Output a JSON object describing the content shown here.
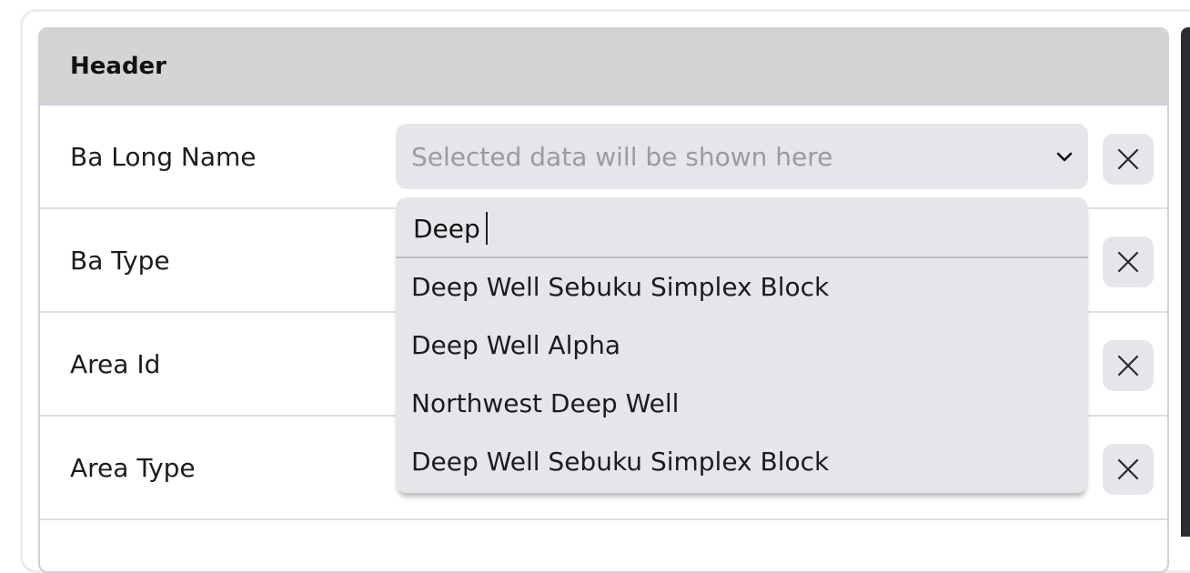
{
  "panel": {
    "header_title": "Header"
  },
  "rows": [
    {
      "label": "Ba Long Name"
    },
    {
      "label": "Ba Type"
    },
    {
      "label": "Area Id"
    },
    {
      "label": "Area Type"
    }
  ],
  "select": {
    "placeholder": "Selected data will be shown here"
  },
  "dropdown": {
    "search_value": "Deep",
    "options": [
      "Deep Well Sebuku Simplex Block",
      "Deep Well Alpha",
      "Northwest Deep Well",
      "Deep Well Sebuku Simplex Block"
    ]
  },
  "icons": {
    "clear": "close-icon",
    "chevron": "chevron-down-icon"
  }
}
